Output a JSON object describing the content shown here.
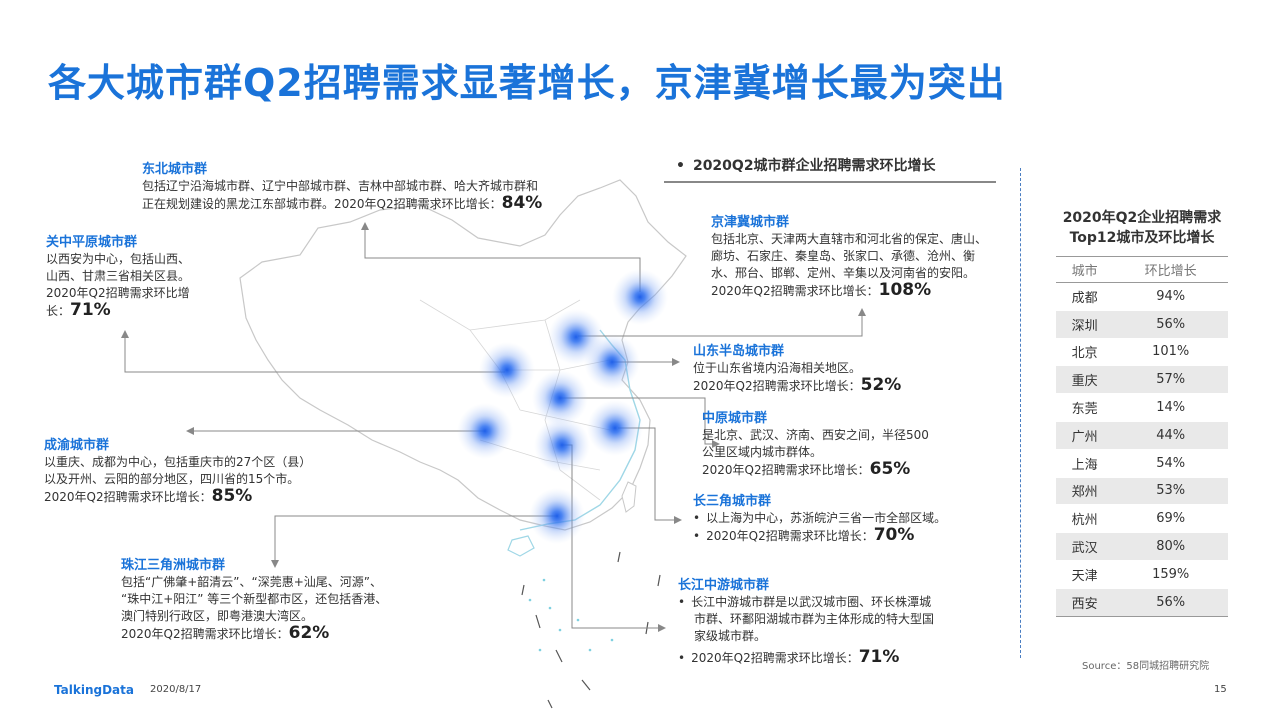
{
  "title": "各大城市群Q2招聘需求显著增长，京津冀增长最为突出",
  "chart_heading": "2020Q2城市群企业招聘需求环比增长",
  "regions": {
    "dongbei": {
      "name": "东北城市群",
      "desc1": "包括辽宁沿海城市群、辽宁中部城市群、吉林中部城市群、哈大齐城市群和",
      "desc2": "正在规划建设的黑龙江东部城市群。2020年Q2招聘需求环比增长：",
      "pct": "84%"
    },
    "guanzhong": {
      "name": "关中平原城市群",
      "desc1": "以西安为中心，包括山西、",
      "desc2": "山西、甘肃三省相关区县。",
      "desc3": "2020年Q2招聘需求环比增",
      "desc4": "长：",
      "pct": "71%"
    },
    "jingjinji": {
      "name": "京津冀城市群",
      "desc1": "包括北京、天津两大直辖市和河北省的保定、唐山、",
      "desc2": "廊坊、石家庄、秦皇岛、张家口、承德、沧州、衡",
      "desc3": "水、邢台、邯郸、定州、辛集以及河南省的安阳。",
      "growth": "2020年Q2招聘需求环比增长：",
      "pct": "108%"
    },
    "shandong": {
      "name": "山东半岛城市群",
      "desc1": "位于山东省境内沿海相关地区。",
      "growth": "2020年Q2招聘需求环比增长：",
      "pct": "52%"
    },
    "zhongyuan": {
      "name": "中原城市群",
      "desc1": "是北京、武汉、济南、西安之间，半径500",
      "desc2": "公里区域内城市群体。",
      "growth": "2020年Q2招聘需求环比增长：",
      "pct": "65%"
    },
    "chengyu": {
      "name": "成渝城市群",
      "desc1": "以重庆、成都为中心，包括重庆市的27个区（县）",
      "desc2": "以及开州、云阳的部分地区，四川省的15个市。",
      "growth": "2020年Q2招聘需求环比增长：",
      "pct": "85%"
    },
    "changsanjiao": {
      "name": "长三角城市群",
      "desc1": "以上海为中心，苏浙皖沪三省一市全部区域。",
      "growth": "2020年Q2招聘需求环比增长：",
      "pct": "70%"
    },
    "zhusanjiao": {
      "name": "珠江三角洲城市群",
      "desc1": "包括“广佛肇+韶清云”、“深莞惠+汕尾、河源”、",
      "desc2": "“珠中江+阳江” 等三个新型都市区，还包括香港、",
      "desc3": "澳门特别行政区，即粤港澳大湾区。",
      "growth": "2020年Q2招聘需求环比增长：",
      "pct": "62%"
    },
    "changjiang": {
      "name": "长江中游城市群",
      "desc1": "长江中游城市群是以武汉城市圈、环长株潭城",
      "desc2": "市群、环鄱阳湖城市群为主体形成的特大型国",
      "desc3": "家级城市群。",
      "growth": "2020年Q2招聘需求环比增长：",
      "pct": "71%"
    }
  },
  "table": {
    "title_line1": "2020年Q2企业招聘需求",
    "title_line2": "Top12城市及环比增长",
    "headers": [
      "城市",
      "环比增长"
    ],
    "rows": [
      [
        "成都",
        "94%"
      ],
      [
        "深圳",
        "56%"
      ],
      [
        "北京",
        "101%"
      ],
      [
        "重庆",
        "57%"
      ],
      [
        "东莞",
        "14%"
      ],
      [
        "广州",
        "44%"
      ],
      [
        "上海",
        "54%"
      ],
      [
        "郑州",
        "53%"
      ],
      [
        "杭州",
        "69%"
      ],
      [
        "武汉",
        "80%"
      ],
      [
        "天津",
        "159%"
      ],
      [
        "西安",
        "56%"
      ]
    ]
  },
  "source": "Source：58同城招聘研究院",
  "footer": {
    "brand": "TalkingData",
    "date": "2020/8/17",
    "page": "15"
  },
  "colors": {
    "accent": "#1a73d9",
    "glow": "#2a6fe0",
    "outline": "#c8c8c8"
  }
}
